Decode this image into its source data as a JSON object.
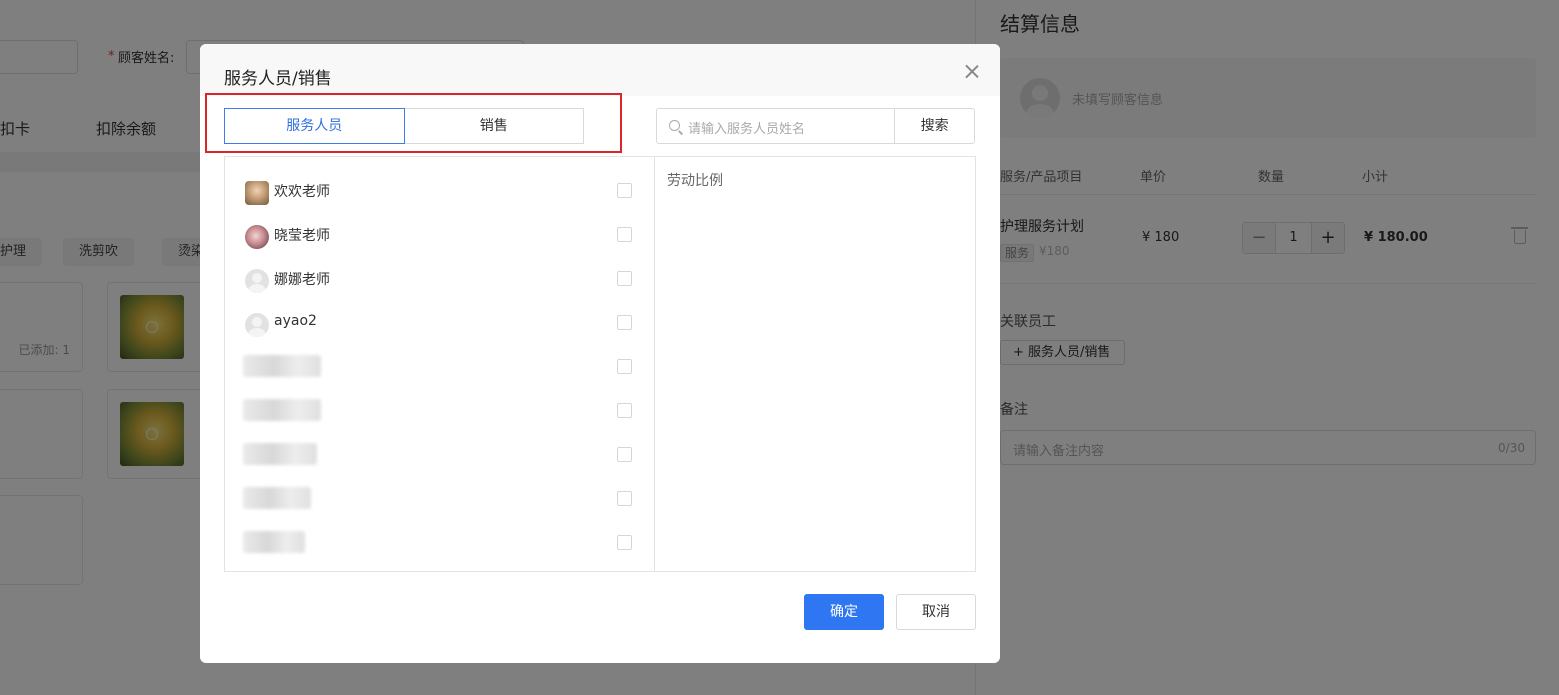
{
  "background": {
    "customer_name_label": "顾客姓名:",
    "required_mark": "*",
    "tabs": [
      "扣卡",
      "扣除余额"
    ],
    "category_chips": [
      "护理",
      "洗剪吹",
      "烫染"
    ],
    "product_added_text": "已添加: 1",
    "settlement": {
      "title": "结算信息",
      "customer_placeholder": "未填写顾客信息",
      "columns": [
        "服务/产品项目",
        "单价",
        "数量",
        "小计"
      ],
      "item": {
        "name": "护理服务计划",
        "tag": "服务",
        "orig_price": "¥180",
        "unit_price": "¥ 180",
        "quantity": "1",
        "subtotal": "¥ 180.00"
      },
      "staff_section_label": "关联员工",
      "add_staff_button": "+ 服务人员/销售",
      "remark_label": "备注",
      "remark_placeholder": "请输入备注内容",
      "remark_counter": "0/30"
    }
  },
  "dialog": {
    "title": "服务人员/销售",
    "tabs": [
      {
        "label": "服务人员",
        "active": true
      },
      {
        "label": "销售",
        "active": false
      }
    ],
    "search": {
      "placeholder": "请输入服务人员姓名",
      "button": "搜索"
    },
    "staff": [
      {
        "name": "欢欢老师",
        "avatar": "photo",
        "checked": false
      },
      {
        "name": "晓莹老师",
        "avatar": "photo",
        "checked": false
      },
      {
        "name": "娜娜老师",
        "avatar": "default",
        "checked": false
      },
      {
        "name": "ayao2",
        "avatar": "default",
        "checked": false
      },
      {
        "name": "",
        "avatar": "blurred",
        "checked": false
      },
      {
        "name": "",
        "avatar": "blurred",
        "checked": false
      },
      {
        "name": "",
        "avatar": "blurred",
        "checked": false
      },
      {
        "name": "",
        "avatar": "blurred",
        "checked": false
      },
      {
        "name": "",
        "avatar": "blurred",
        "checked": false
      }
    ],
    "ratio_label": "劳动比例",
    "confirm_button": "确定",
    "cancel_button": "取消"
  },
  "colors": {
    "primary": "#2f77f2",
    "highlight_box": "#d9262a",
    "active_tab_text": "#2f6fe0"
  }
}
